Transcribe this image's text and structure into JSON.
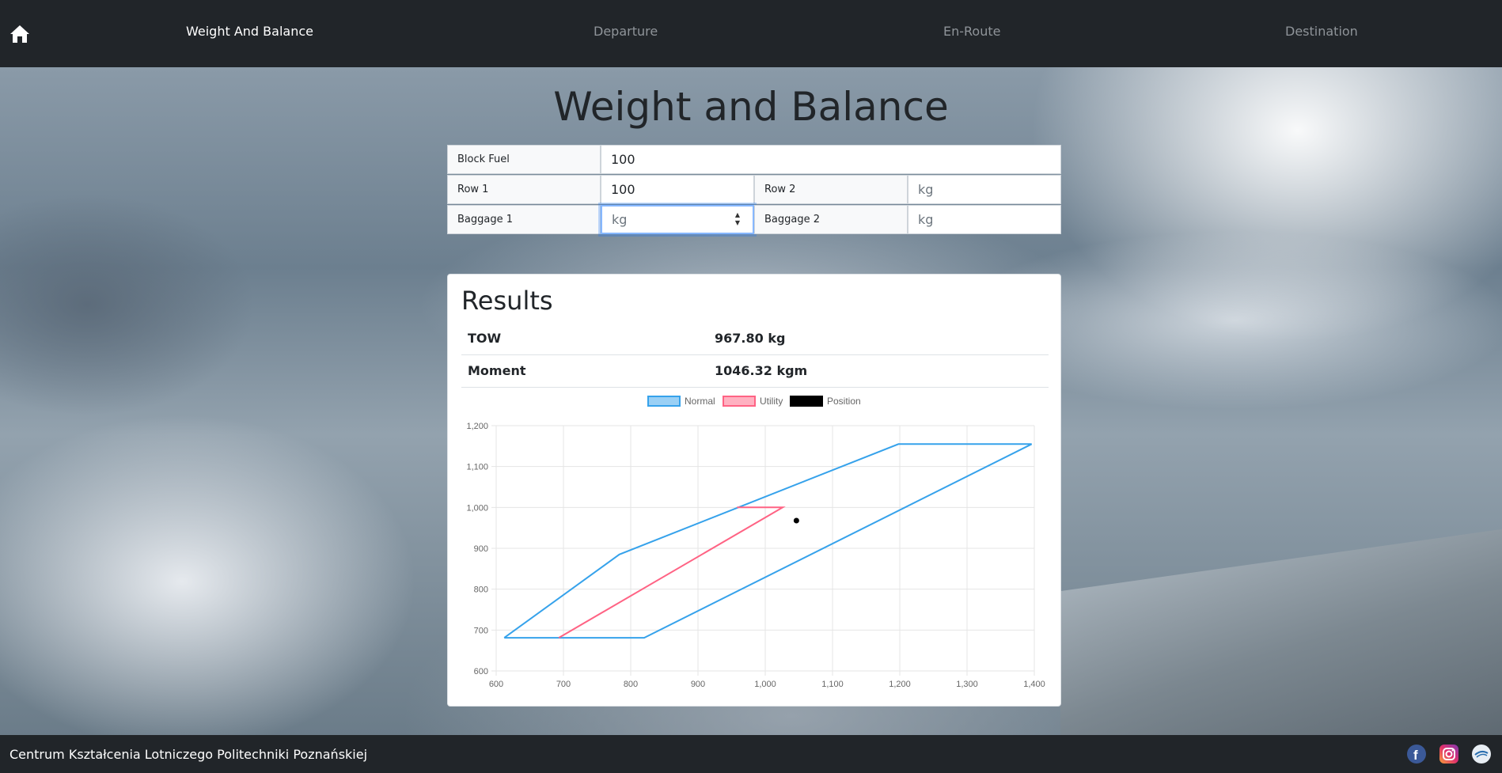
{
  "nav": {
    "items": [
      {
        "label": "Weight And Balance",
        "active": true
      },
      {
        "label": "Departure",
        "active": false
      },
      {
        "label": "En-Route",
        "active": false
      },
      {
        "label": "Destination",
        "active": false
      }
    ]
  },
  "page_title": "Weight and Balance",
  "form": {
    "block_fuel": {
      "label": "Block Fuel",
      "value": "100"
    },
    "row1": {
      "label": "Row 1",
      "value": "100"
    },
    "row2": {
      "label": "Row 2",
      "placeholder": "kg"
    },
    "baggage1": {
      "label": "Baggage 1",
      "placeholder": "kg"
    },
    "baggage2": {
      "label": "Baggage 2",
      "placeholder": "kg"
    }
  },
  "results": {
    "title": "Results",
    "rows": [
      {
        "label": "TOW",
        "value": "967.80 kg"
      },
      {
        "label": "Moment",
        "value": "1046.32 kgm"
      }
    ]
  },
  "chart_data": {
    "type": "scatter",
    "legend": [
      "Normal",
      "Utility",
      "Position"
    ],
    "legend_position": "top",
    "grid": true,
    "xlim": [
      600,
      1400
    ],
    "ylim": [
      600,
      1200
    ],
    "x_ticks": [
      "600",
      "700",
      "800",
      "900",
      "1,000",
      "1,100",
      "1,200",
      "1,300",
      "1,400"
    ],
    "y_ticks": [
      "600",
      "700",
      "800",
      "900",
      "1,000",
      "1,100",
      "1,200"
    ],
    "series": [
      {
        "name": "Normal",
        "color": "#36a2eb",
        "fill": "#9ad0f5",
        "points": [
          [
            612,
            681
          ],
          [
            783,
            885
          ],
          [
            960,
            1000
          ],
          [
            1198,
            1155
          ],
          [
            1396,
            1155
          ],
          [
            820,
            681
          ],
          [
            612,
            681
          ]
        ]
      },
      {
        "name": "Utility",
        "color": "#ff6384",
        "fill": "#ffb1c1",
        "points": [
          [
            693,
            681
          ],
          [
            1026,
            1000
          ],
          [
            958,
            1000
          ]
        ]
      },
      {
        "name": "Position",
        "color": "#000000",
        "points": [
          [
            1046.32,
            967.8
          ]
        ]
      }
    ]
  },
  "footer": {
    "text": "Centrum Kształcenia Lotniczego Politechniki Poznańskiej",
    "icons": [
      "facebook-icon",
      "instagram-icon",
      "website-icon"
    ]
  }
}
